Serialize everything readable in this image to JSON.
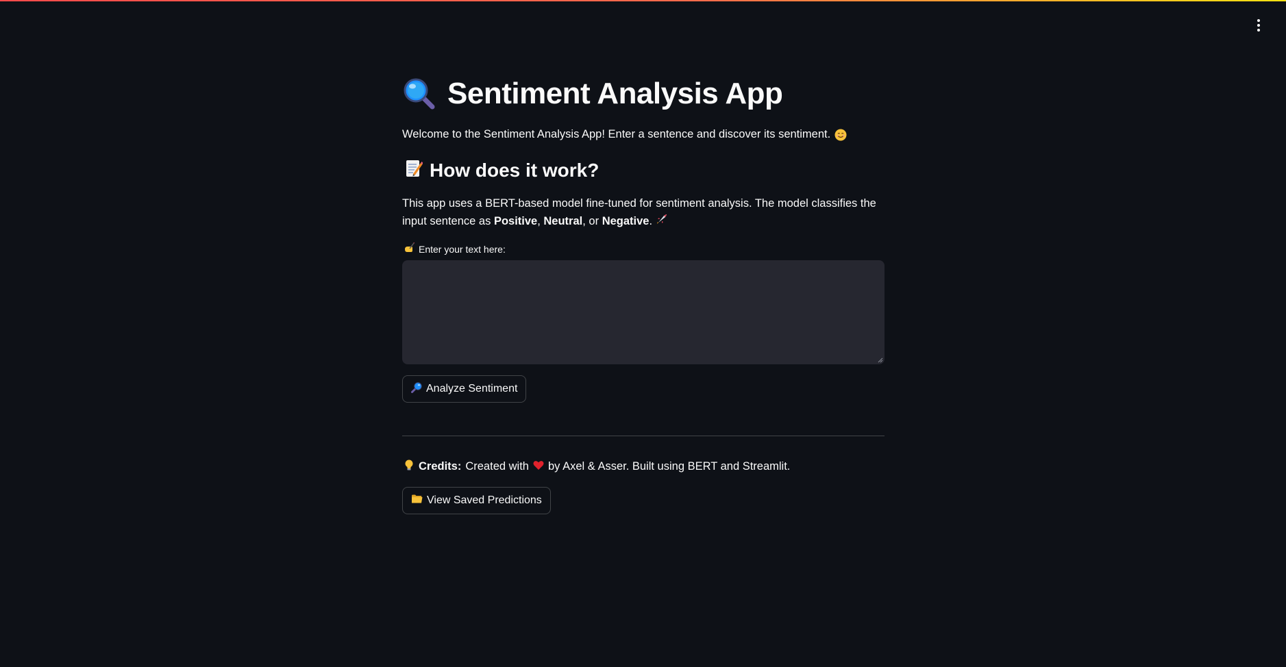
{
  "app": {
    "title": "Sentiment Analysis App",
    "title_icon": "magnifying-glass-icon",
    "menu_icon": "kebab-menu-icon"
  },
  "welcome": {
    "text": "Welcome to the Sentiment Analysis App! Enter a sentence and discover its sentiment.",
    "icon": "smiling-face-icon"
  },
  "how_it_works": {
    "heading": "How does it work?",
    "icon": "memo-icon",
    "desc_part1": "This app uses a BERT-based model fine-tuned for sentiment analysis. The model classifies the input sentence as ",
    "positive": "Positive",
    "sep1": ", ",
    "neutral": "Neutral",
    "sep2": ", or ",
    "negative": "Negative",
    "desc_end": ".",
    "end_icon": "rocket-icon"
  },
  "input": {
    "label": "Enter your text here:",
    "label_icon": "writing-hand-icon",
    "value": "",
    "placeholder": ""
  },
  "analyze_button": {
    "label": "Analyze Sentiment",
    "icon": "magnifying-glass-tilted-icon"
  },
  "credits": {
    "icon": "light-bulb-icon",
    "label": "Credits:",
    "text_before": "Created with",
    "heart_icon": "heart-icon",
    "text_after": "by Axel & Asser. Built using BERT and Streamlit."
  },
  "saved_button": {
    "label": "View Saved Predictions",
    "icon": "folder-icon"
  },
  "colors": {
    "background": "#0e1117",
    "text": "#fafafa",
    "input_bg": "#262730",
    "accent": "#ff4b4b"
  }
}
